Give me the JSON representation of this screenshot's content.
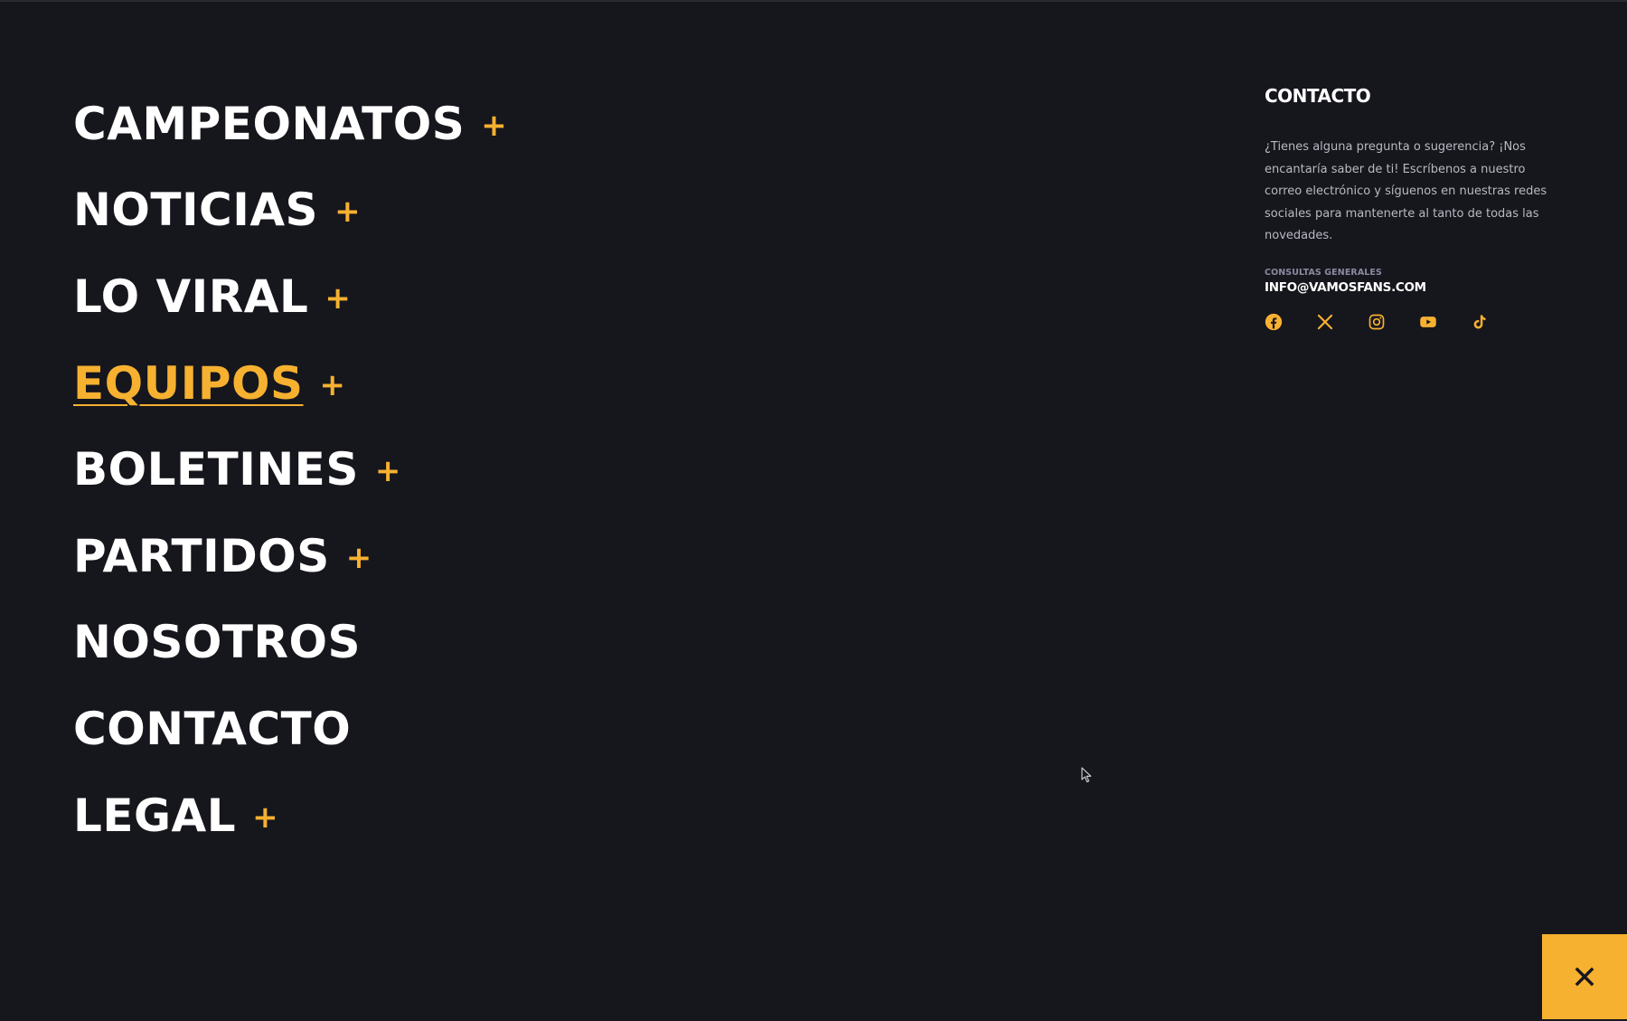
{
  "menu": {
    "items": [
      {
        "label": "CAMPEONATOS",
        "has_submenu": true,
        "active": false
      },
      {
        "label": "NOTICIAS",
        "has_submenu": true,
        "active": false
      },
      {
        "label": "LO VIRAL",
        "has_submenu": true,
        "active": false
      },
      {
        "label": "EQUIPOS",
        "has_submenu": true,
        "active": true
      },
      {
        "label": "BOLETINES",
        "has_submenu": true,
        "active": false
      },
      {
        "label": "PARTIDOS",
        "has_submenu": true,
        "active": false
      },
      {
        "label": "NOSOTROS",
        "has_submenu": false,
        "active": false
      },
      {
        "label": "CONTACTO",
        "has_submenu": false,
        "active": false
      },
      {
        "label": "LEGAL",
        "has_submenu": true,
        "active": false
      }
    ],
    "expand_symbol": "+"
  },
  "contact": {
    "title": "CONTACTO",
    "description": "¿Tienes alguna pregunta o sugerencia? ¡Nos encantaría saber de ti! Escríbenos a nuestro correo electrónico y síguenos en nuestras redes sociales para mantenerte al tanto de todas las novedades.",
    "email_label": "CONSULTAS GENERALES",
    "email": "INFO@VAMOSFANS.COM",
    "social": [
      {
        "icon": "facebook-icon"
      },
      {
        "icon": "x-twitter-icon"
      },
      {
        "icon": "instagram-icon"
      },
      {
        "icon": "youtube-icon"
      },
      {
        "icon": "tiktok-icon"
      }
    ]
  },
  "close_button": {
    "icon": "close-icon"
  },
  "colors": {
    "background": "#16161d",
    "accent": "#f6b130",
    "text": "#ffffff",
    "muted_text": "#b9b9c2"
  }
}
